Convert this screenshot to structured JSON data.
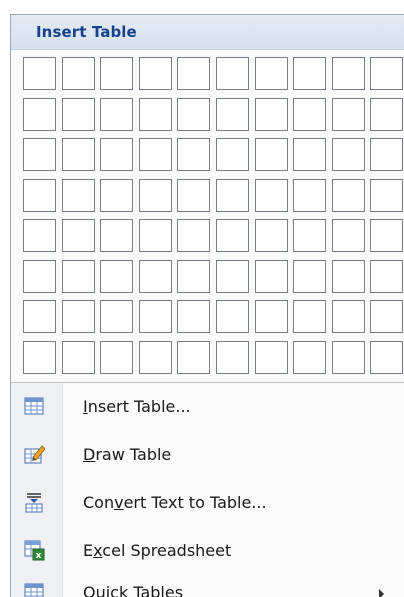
{
  "header": {
    "title": "Insert Table"
  },
  "grid": {
    "columns": 10,
    "rows": 8
  },
  "items": [
    {
      "pre": "",
      "key": "I",
      "post": "nsert Table...",
      "icon": "table-icon"
    },
    {
      "pre": "",
      "key": "D",
      "post": "raw Table",
      "icon": "pencil-table-icon"
    },
    {
      "pre": "Con",
      "key": "v",
      "post": "ert Text to Table...",
      "icon": "text-to-table-icon"
    },
    {
      "pre": "E",
      "key": "x",
      "post": "cel Spreadsheet",
      "icon": "excel-icon"
    },
    {
      "pre": "Quick ",
      "key": "T",
      "post": "ables",
      "icon": "table-icon",
      "submenu": true
    }
  ]
}
